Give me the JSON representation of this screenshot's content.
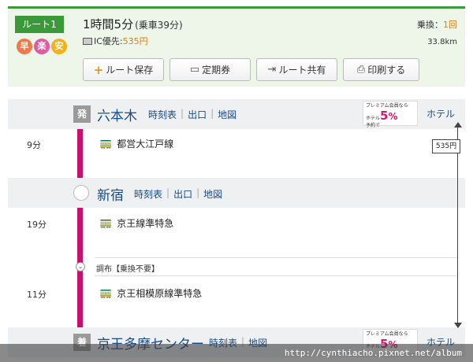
{
  "route": {
    "badge": "ルート1",
    "icons": [
      "早",
      "楽",
      "安"
    ],
    "duration": "1時間5分",
    "duration_sub": "(乗車39分)",
    "ic_label": "IC優先:",
    "fare": "535円",
    "transfer_label": "乗換：",
    "transfer_count": "1回",
    "distance": "33.8km",
    "buttons": {
      "save": "ルート保存",
      "pass": "定期券",
      "share": "ルート共有",
      "print": "印刷する"
    }
  },
  "stations": [
    {
      "mark": "発",
      "name": "六本木",
      "links": [
        "時刻表",
        "出口",
        "地図"
      ],
      "hotel": "ホテル"
    },
    {
      "mark": "",
      "name": "新宿",
      "links": [
        "時刻表",
        "出口",
        "地図"
      ],
      "hotel": ""
    },
    {
      "mark": "着",
      "name": "京王多摩センター",
      "links": [
        "時刻表",
        "地図"
      ],
      "hotel": "ホテル"
    }
  ],
  "segments": [
    {
      "minutes": "9分",
      "line": "都営大江戸線"
    },
    {
      "minutes": "19分",
      "line": "京王線準特急"
    },
    {
      "minutes": "11分",
      "line": "京王相模原線準特急"
    }
  ],
  "through": "調布【乗換不要】",
  "fare_box": "535円",
  "premium": {
    "line1": "プレミアム会員なら",
    "line2": "ホテル",
    "line3": "予約で",
    "pct": "5",
    "unit": "%"
  },
  "watermark": "http://cynthiacho.pixnet.net/album"
}
